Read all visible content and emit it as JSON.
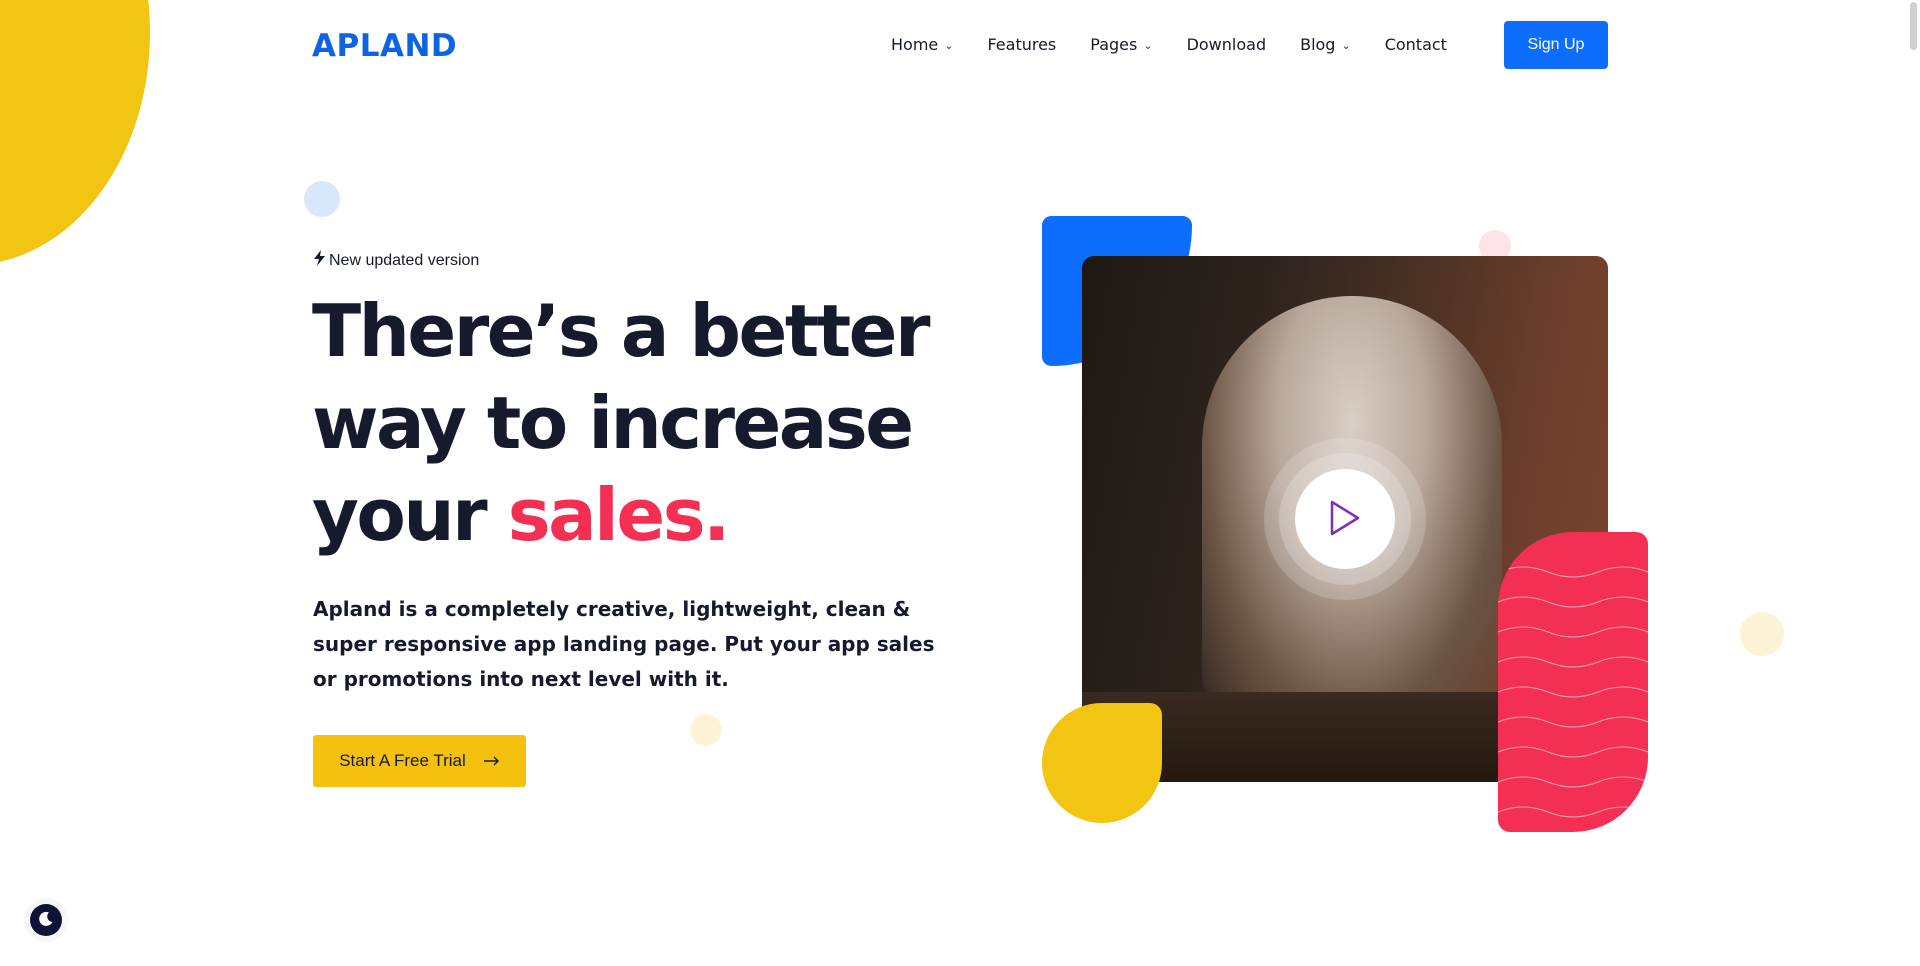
{
  "brand": {
    "logo": "APLAND",
    "color": "#0e63e2"
  },
  "nav": {
    "items": [
      {
        "label": "Home",
        "has_dropdown": true
      },
      {
        "label": "Features",
        "has_dropdown": false
      },
      {
        "label": "Pages",
        "has_dropdown": true
      },
      {
        "label": "Download",
        "has_dropdown": false
      },
      {
        "label": "Blog",
        "has_dropdown": true
      },
      {
        "label": "Contact",
        "has_dropdown": false
      }
    ],
    "signup_label": "Sign Up"
  },
  "hero": {
    "badge": "New updated version",
    "headline_line1": "There’s a better",
    "headline_line2": "way to increase",
    "headline_line3_prefix": "your ",
    "headline_accent": "sales.",
    "lead": "Apland is a completely creative, lightweight, clean & super responsive app landing page. Put your app sales or promotions into next level with it.",
    "cta_label": "Start A Free Trial",
    "accent_color": "#f42f54",
    "cta_color": "#f6c10e",
    "primary_color": "#0d6efd"
  },
  "media": {
    "play_icon": "play-icon"
  },
  "theme_toggle": {
    "icon": "moon-icon"
  }
}
